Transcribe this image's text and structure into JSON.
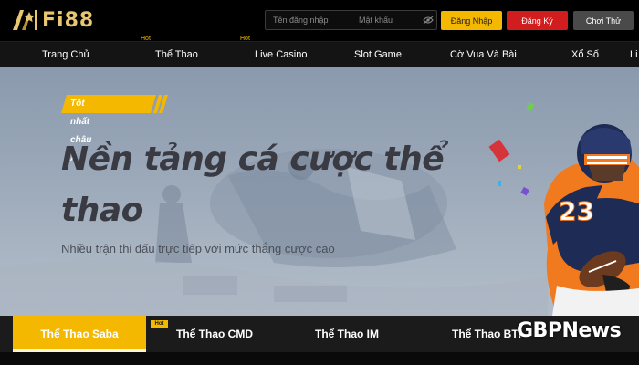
{
  "brand": {
    "logo_text": "Fi88",
    "accent": "#f5b800",
    "logo_color": "#e8c770"
  },
  "header": {
    "username_placeholder": "Tên đăng nhập",
    "password_placeholder": "Mật khẩu",
    "login_label": "Đăng Nhập",
    "register_label": "Đăng Ký",
    "trial_label": "Chơi Thử",
    "eye_icon": "eye-icon"
  },
  "nav": {
    "items": [
      {
        "label": "Trang Chủ",
        "hot": ""
      },
      {
        "label": "Thể Thao",
        "hot": "Hot"
      },
      {
        "label": "Live Casino",
        "hot": "Hot"
      },
      {
        "label": "Slot Game",
        "hot": ""
      },
      {
        "label": "Cờ Vua Và Bài",
        "hot": ""
      },
      {
        "label": "Xổ Số",
        "hot": ""
      },
      {
        "label": "Li",
        "hot": ""
      }
    ]
  },
  "hero": {
    "badge": "Tốt nhất châu Á",
    "title": "Nền tảng cá cược thể thao",
    "subtitle": "Nhiều trận thi đấu trực tiếp với mức thắng cược cao",
    "player_number": "23"
  },
  "tabs": {
    "items": [
      {
        "label": "Thể Thao Saba"
      },
      {
        "label": "Thể Thao CMD"
      },
      {
        "label": "Thể Thao IM"
      },
      {
        "label": "Thể Thao BTI"
      }
    ],
    "hot_tag": "Hot",
    "active_index": 0
  },
  "watermark": "GBPNews"
}
